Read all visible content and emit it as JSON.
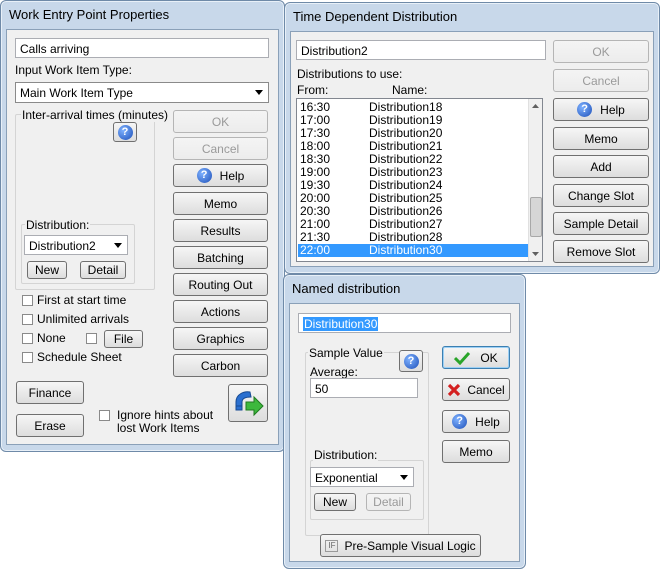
{
  "work_entry": {
    "title": "Work Entry Point Properties",
    "name_value": "Calls arriving",
    "input_type_label": "Input Work Item Type:",
    "input_type_value": "Main Work Item Type",
    "inter_arrival_label": "Inter-arrival times (minutes)",
    "distribution_label": "Distribution:",
    "distribution_value": "Distribution2",
    "new_label": "New",
    "detail_label": "Detail",
    "first_at_start_label": "First at start time",
    "unlimited_label": "Unlimited arrivals",
    "none_label": "None",
    "file_label": "File",
    "schedule_label": "Schedule Sheet",
    "finance_label": "Finance",
    "erase_label": "Erase",
    "ignore_hints_line1": "Ignore hints about",
    "ignore_hints_line2": "lost Work Items",
    "buttons": {
      "ok": "OK",
      "cancel": "Cancel",
      "help": "Help",
      "memo": "Memo",
      "results": "Results",
      "batching": "Batching",
      "routing_out": "Routing Out",
      "actions": "Actions",
      "graphics": "Graphics",
      "carbon": "Carbon"
    }
  },
  "time_dep": {
    "title": "Time Dependent Distribution",
    "name_value": "Distribution2",
    "dist_to_use_label": "Distributions to use:",
    "from_label": "From:",
    "name_label": "Name:",
    "rows": [
      {
        "from": "16:30",
        "name": "Distribution18"
      },
      {
        "from": "17:00",
        "name": "Distribution19"
      },
      {
        "from": "17:30",
        "name": "Distribution20"
      },
      {
        "from": "18:00",
        "name": "Distribution21"
      },
      {
        "from": "18:30",
        "name": "Distribution22"
      },
      {
        "from": "19:00",
        "name": "Distribution23"
      },
      {
        "from": "19:30",
        "name": "Distribution24"
      },
      {
        "from": "20:00",
        "name": "Distribution25"
      },
      {
        "from": "20:30",
        "name": "Distribution26"
      },
      {
        "from": "21:00",
        "name": "Distribution27"
      },
      {
        "from": "21:30",
        "name": "Distribution28"
      },
      {
        "from": "22:00",
        "name": "Distribution30"
      }
    ],
    "buttons": {
      "ok": "OK",
      "cancel": "Cancel",
      "help": "Help",
      "memo": "Memo",
      "add": "Add",
      "change_slot": "Change Slot",
      "sample_detail": "Sample Detail",
      "remove_slot": "Remove Slot"
    }
  },
  "named_dist": {
    "title": "Named distribution",
    "name_value": "Distribution30",
    "sample_value_label": "Sample Value",
    "average_label": "Average:",
    "average_value": "50",
    "distribution_label": "Distribution:",
    "distribution_value": "Exponential",
    "new_label": "New",
    "detail_label": "Detail",
    "presample_label": "Pre-Sample Visual Logic",
    "buttons": {
      "ok": "OK",
      "cancel": "Cancel",
      "help": "Help",
      "memo": "Memo"
    }
  }
}
